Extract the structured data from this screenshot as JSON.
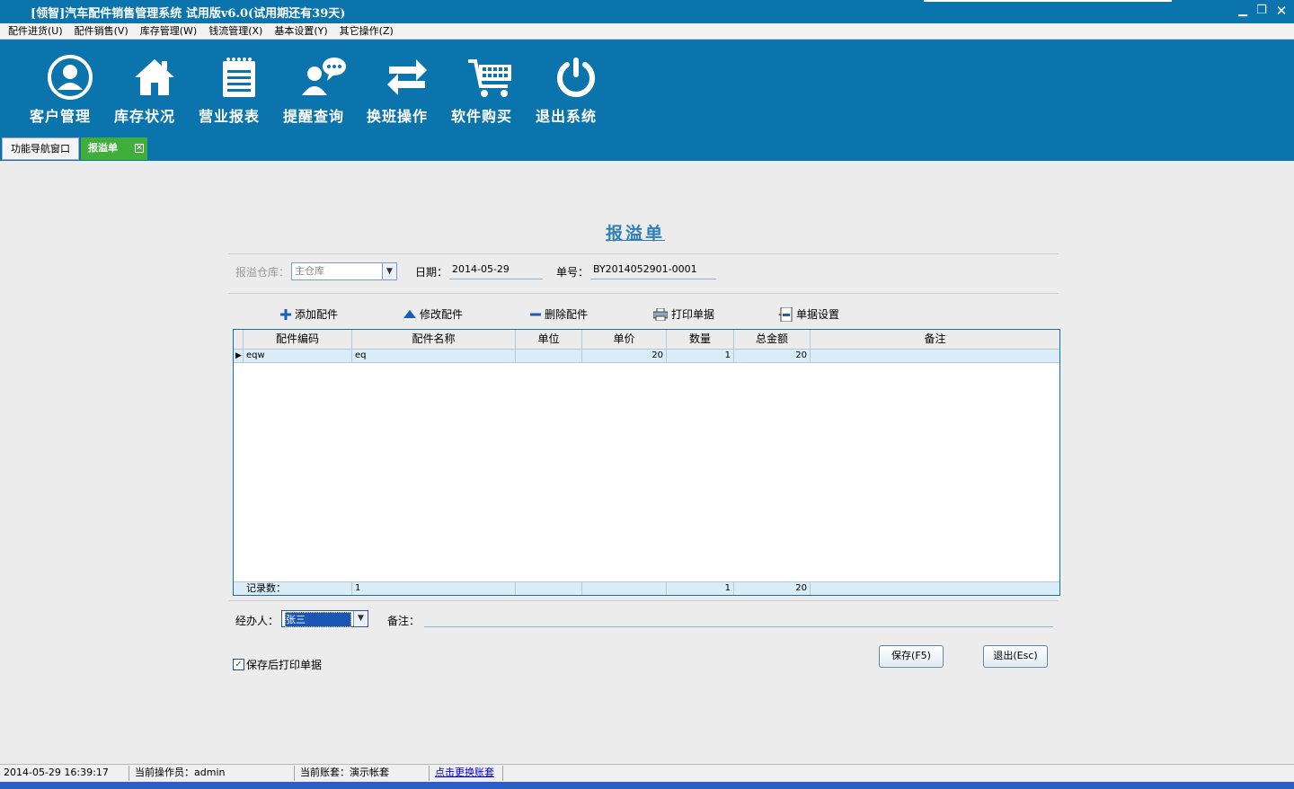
{
  "window": {
    "title": "[领智]汽车配件销售管理系统  试用版v6.0(试用期还有39天)"
  },
  "menu": [
    {
      "label": "配件进货(U)"
    },
    {
      "label": "配件销售(V)"
    },
    {
      "label": "库存管理(W)"
    },
    {
      "label": "钱流管理(X)"
    },
    {
      "label": "基本设置(Y)"
    },
    {
      "label": "其它操作(Z)"
    }
  ],
  "toolbar": [
    {
      "label": "客户管理",
      "icon": "user-icon"
    },
    {
      "label": "库存状况",
      "icon": "house-icon"
    },
    {
      "label": "营业报表",
      "icon": "notepad-icon"
    },
    {
      "label": "提醒查询",
      "icon": "chat-user-icon"
    },
    {
      "label": "换班操作",
      "icon": "exchange-icon"
    },
    {
      "label": "软件购买",
      "icon": "cart-icon"
    },
    {
      "label": "退出系统",
      "icon": "power-icon"
    }
  ],
  "tabs": [
    {
      "label": "功能导航窗口"
    },
    {
      "label": "报溢单"
    }
  ],
  "form": {
    "title": "报溢单",
    "warehouse_label": "报溢仓库：",
    "warehouse_value": "主仓库",
    "date_label": "日期：",
    "date_value": "2014-05-29",
    "no_label": "单号：",
    "no_value": "BY2014052901-0001",
    "actions": [
      {
        "label": "添加配件",
        "icon": "plus-icon"
      },
      {
        "label": "修改配件",
        "icon": "triangle-up-icon"
      },
      {
        "label": "删除配件",
        "icon": "minus-icon"
      },
      {
        "label": "打印单据",
        "icon": "printer-icon"
      },
      {
        "label": "单据设置",
        "icon": "settings-doc-icon"
      }
    ],
    "columns": [
      "配件编码",
      "配件名称",
      "单位",
      "单价",
      "数量",
      "总金额",
      "备注"
    ],
    "rows": [
      {
        "code": "eqw",
        "name": "eq",
        "unit": "",
        "price": "20",
        "qty": "1",
        "total": "20",
        "note": ""
      }
    ],
    "footer": {
      "label": "记录数：",
      "count": "1",
      "qty": "1",
      "total": "20"
    },
    "handler_label": "经办人：",
    "handler_value": "张三",
    "note_label": "备注：",
    "print_after_save": "保存后打印单据",
    "save_label": "保存(F5)",
    "exit_label": "退出(Esc)"
  },
  "status": {
    "datetime": "2014-05-29 16:39:17",
    "operator": "当前操作员：admin",
    "account": "当前账套：演示帐套",
    "switch_link": "点击更换账套"
  },
  "colors": {
    "primary": "#0c74ac",
    "tab_active": "#3fae3a",
    "grid_row": "#d9ecf7"
  }
}
